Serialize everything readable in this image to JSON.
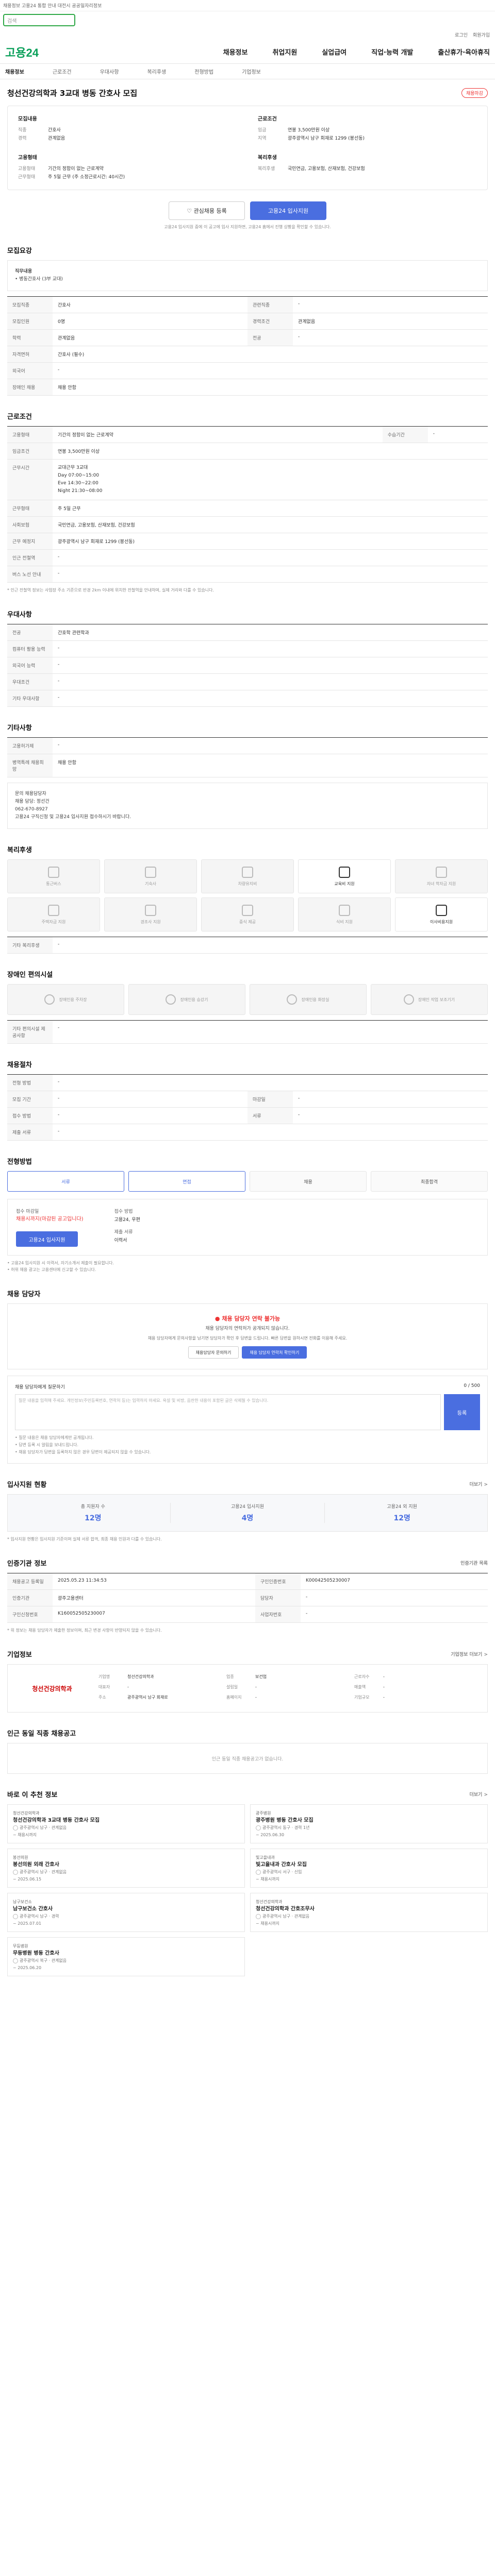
{
  "topbar": {
    "text": "채용정보 고용24 통합 안내 대전시 공공일자리정보"
  },
  "search": {
    "placeholder": "검색"
  },
  "util": [
    "로그인",
    "회원가입"
  ],
  "logo": "고용24",
  "gnb": [
    "채용정보",
    "취업지원",
    "실업급여",
    "직업·능력 개발",
    "출산휴가·육아휴직"
  ],
  "subnav": [
    "채용정보",
    "근로조건",
    "우대사항",
    "복리후생",
    "전형방법",
    "기업정보"
  ],
  "title": "청선건강의학과 3교대 병동 간호사 모집",
  "badge": "채용마감",
  "summary": {
    "col1_title": "모집내용",
    "col1": [
      [
        "직종",
        "간호사"
      ],
      [
        "경력",
        "관계없음"
      ]
    ],
    "col2_title": "근로조건",
    "col2": [
      [
        "임금",
        "연봉 3,500만원 이상"
      ],
      [
        "지역",
        "광주광역시 남구 회재로 1299 (봉선동)"
      ]
    ],
    "col3_title": "고용형태",
    "col3": [
      [
        "고용형태",
        "기간의 정함이 없는 근로계약"
      ],
      [
        "근무형태",
        "주 5일 근무 (주 소정근로시간: 40시간)"
      ]
    ],
    "col4_title": "복리후생",
    "col4": [
      [
        "복리후생",
        "국민연금, 고용보험, 산재보험, 건강보험"
      ]
    ]
  },
  "buttons": {
    "interest": "관심채용 등록",
    "apply": "고용24 입사지원"
  },
  "note": "고용24 입사지원 중에 이 공고에 입사 지원하면, 고용24 홈에서 진행 상황을 확인할 수 있습니다.",
  "recruit": {
    "title": "모집요강",
    "box_title": "직무내용",
    "box_text": "• 병동간호사 (3부 교대)",
    "rows": [
      [
        "모집직종",
        "간호사",
        "관련직종",
        "-"
      ],
      [
        "모집인원",
        "0명",
        "경력조건",
        "관계없음"
      ],
      [
        "학력",
        "관계없음",
        "전공",
        "-"
      ],
      [
        "자격면허",
        "간호사 (필수)",
        "",
        ""
      ],
      [
        "외국어",
        "-",
        "",
        ""
      ],
      [
        "장애인 채용",
        "채용 안함",
        "",
        ""
      ]
    ]
  },
  "conditions": {
    "title": "근로조건",
    "rows": [
      [
        "고용형태",
        "기간의 정함이 없는 근로계약",
        "수습기간",
        "-"
      ],
      [
        "임금조건",
        "연봉 3,500만원 이상",
        "",
        ""
      ]
    ],
    "hours_k": "근무시간",
    "hours": [
      "교대근무 3교대",
      "Day 07:00~15:00",
      "Eve 14:30~22:00",
      "Night 21:30~08:00"
    ],
    "rows2": [
      [
        "근무형태",
        "주 5일 근무"
      ],
      [
        "사회보험",
        "국민연금, 고용보험, 산재보험, 건강보험"
      ],
      [
        "근무 예정지",
        "광주광역시 남구 회재로 1299 (봉선동)"
      ],
      [
        "인근 전철역",
        "-"
      ],
      [
        "버스 노선 안내",
        "-"
      ]
    ],
    "note": "* 인근 전철역 정보는 사업장 주소 기준으로 반경 2km 이내에 위치한 전철역을 안내하며, 실제 거리와 다를 수 있습니다."
  },
  "prefer": {
    "title": "우대사항",
    "rows": [
      [
        "전공",
        "간호학 관련학과"
      ],
      [
        "컴퓨터 활용 능력",
        "-"
      ],
      [
        "외국어 능력",
        "-"
      ],
      [
        "우대조건",
        "-"
      ],
      [
        "기타 우대사항",
        "-"
      ]
    ]
  },
  "other": {
    "title": "기타사항",
    "rows": [
      [
        "고용허가제",
        "-"
      ],
      [
        "병역특례 채용희망",
        "채용 안함"
      ]
    ]
  },
  "contact": {
    "label": "문의 채용담당자",
    "name": "채용 담당: 정선건",
    "phone": "062-670-8927",
    "text": "고용24 구직신청 및 고용24 입사지원 접수하시기 바랍니다."
  },
  "welfare": {
    "title": "복리후생",
    "tiles": [
      "통근버스",
      "기숙사",
      "차량유지비",
      "교육비 지원",
      "자녀 학자금 지원",
      "주택자금 지원",
      "경조사 지원",
      "중식 제공",
      "식비 지원",
      "이사비용지원"
    ],
    "on": [
      3,
      9
    ],
    "etc_k": "기타 복리후생",
    "etc_v": "-"
  },
  "disabled": {
    "title": "장애인 편의시설",
    "tiles": [
      "장애인용 주차장",
      "장애인용 승강기",
      "장애인용 화장실",
      "장애인 작업 보조기기"
    ],
    "etc_k": "기타 편의시설 제공사항",
    "etc_v": "-"
  },
  "process": {
    "title": "채용절차",
    "rows": [
      [
        "전형 방법",
        "-"
      ],
      [
        "모집 기간",
        "-",
        "마감일",
        "-"
      ],
      [
        "접수 방법",
        "-",
        "서류",
        "-"
      ],
      [
        "제출 서류",
        "-"
      ]
    ],
    "steps": [
      "서류",
      "면접",
      "채용",
      "최종합격"
    ]
  },
  "apply": {
    "title": "전형방법",
    "k1": "접수 마감일",
    "v1": "채용시까지(마감된 공고입니다)",
    "k2": "접수 방법",
    "v2": "고용24, 우편",
    "k3": "제출 서류",
    "v3": "이력서",
    "btn": "고용24 입사지원",
    "notes": [
      "• 고용24 입사지원 시 이력서, 자기소개서 제출이 필요합니다.",
      "• 허위 채용 광고는 고용센터에 신고할 수 있습니다."
    ]
  },
  "inquiry": {
    "title": "채용 담당자",
    "alert_a": "채용 담당자 연락 불가능",
    "alert_b": "채용 담당자의 연락처가 공개되지 않습니다.",
    "desc": "채용 담당자에게 문의사항을 남기면 담당자가 확인 후 답변을 드립니다. 빠른 답변을 원하시면 전화를 이용해 주세요.",
    "btn1": "채용담당자 문의하기",
    "btn2": "채용 담당자 연락처 확인하기",
    "q_title": "채용 담당자에게 질문하기",
    "q_count": "0 / 500",
    "placeholder": "질문 내용을 입력해 주세요. 개인정보(주민등록번호, 연락처 등)는 입력하지 마세요. 욕설 및 비방, 음란한 내용이 포함된 글은 삭제될 수 있습니다.",
    "send": "등록",
    "q_notes": [
      "• 질문 내용은 채용 담당자에게만 공개됩니다.",
      "• 답변 등록 시 알림을 보내드립니다.",
      "• 채용 담당자가 답변을 등록하지 않은 경우 답변이 제공되지 않을 수 있습니다."
    ]
  },
  "stats": {
    "title": "입사지원 현황",
    "more": "더보기 >",
    "items": [
      [
        "총 지원자 수",
        "12명"
      ],
      [
        "고용24 입사지원",
        "4명"
      ],
      [
        "고용24 외 지원",
        "12명"
      ]
    ],
    "note": "* 입사지원 현황은 입사지원 기준이며 실제 서류 합격, 최종 채용 인원과 다를 수 있습니다."
  },
  "meta": {
    "title": "인증기관 정보",
    "right": "인증기관 목록",
    "rows": [
      [
        "채용공고 등록일",
        "2025.05.23 11:34:53",
        "구인인증번호",
        "K00042505230007"
      ],
      [
        "인증기관",
        "광주고용센터",
        "담당자",
        "-"
      ],
      [
        "구인신청번호",
        "K160052505230007",
        "사업자번호",
        "-"
      ]
    ],
    "note": "* 위 정보는 채용 담당자가 제출한 정보이며, 최근 변경 사항이 반영되지 않을 수 있습니다."
  },
  "company": {
    "title": "기업정보",
    "more": "기업정보 더보기 >",
    "logo": "청선건강의학과",
    "rows": [
      [
        "기업명",
        "청선건강의학과",
        "업종",
        "보건업",
        "근로자수",
        "-"
      ],
      [
        "대표자",
        "-",
        "설립일",
        "-",
        "매출액",
        "-"
      ],
      [
        "주소",
        "광주광역시 남구 회재로",
        "홈페이지",
        "-",
        "기업규모",
        "-"
      ]
    ]
  },
  "related": {
    "title": "인근 동일 직종 채용공고",
    "empty": "인근 동일 직종 채용공고가 없습니다."
  },
  "recommend": {
    "title": "바로 이 추천 정보",
    "more": "더보기 >",
    "cards": [
      {
        "co": "청선건강의학과",
        "ti": "청선건강의학과 3교대 병동 간호사 모집",
        "meta": "광주광역시 남구 · 관계없음",
        "date": "~ 채용시까지"
      },
      {
        "co": "광주병원",
        "ti": "광주병원 병동 간호사 모집",
        "meta": "광주광역시 동구 · 경력 1년",
        "date": "~ 2025.06.30"
      },
      {
        "co": "봉선의원",
        "ti": "봉선의원 외래 간호사",
        "meta": "광주광역시 남구 · 관계없음",
        "date": "~ 2025.06.15"
      },
      {
        "co": "빛고을내과",
        "ti": "빛고을내과 간호사 모집",
        "meta": "광주광역시 서구 · 신입",
        "date": "~ 채용시까지"
      },
      {
        "co": "남구보건소",
        "ti": "남구보건소 간호사",
        "meta": "광주광역시 남구 · 경력",
        "date": "~ 2025.07.01"
      },
      {
        "co": "청선건강의학과",
        "ti": "청선건강의학과 간호조무사",
        "meta": "광주광역시 남구 · 관계없음",
        "date": "~ 채용시까지"
      },
      {
        "co": "무등병원",
        "ti": "무등병원 병동 간호사",
        "meta": "광주광역시 북구 · 관계없음",
        "date": "~ 2025.06.20"
      }
    ]
  }
}
